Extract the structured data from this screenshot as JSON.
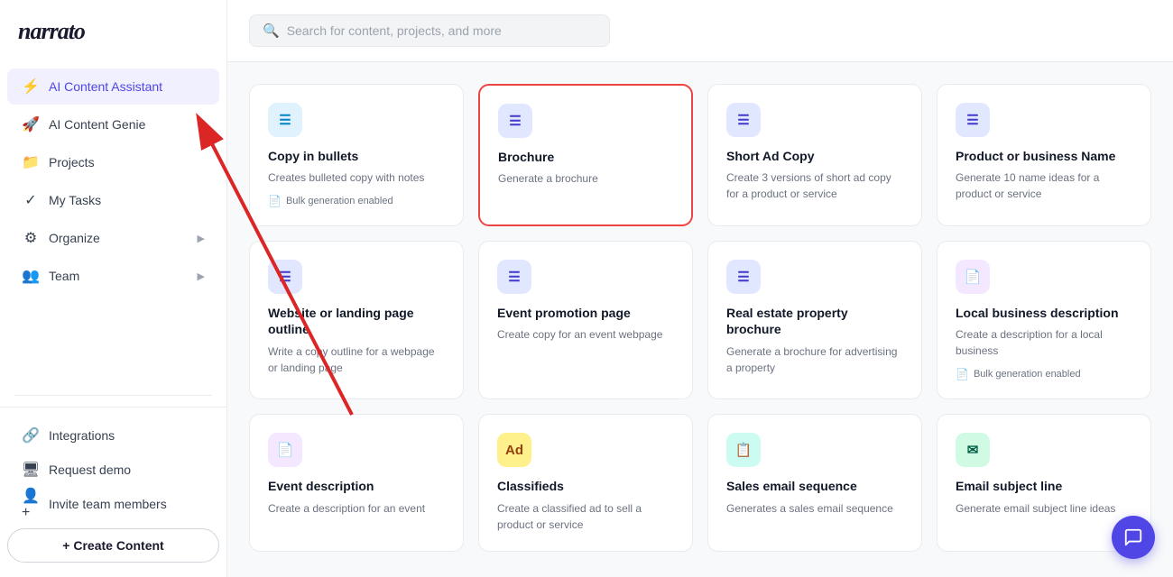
{
  "app": {
    "logo": "narrato"
  },
  "sidebar": {
    "nav_items": [
      {
        "id": "ai-content-assistant",
        "label": "AI Content Assistant",
        "icon": "⚡",
        "active": true,
        "has_chevron": false,
        "icon_color": "#f59e0b"
      },
      {
        "id": "ai-content-genie",
        "label": "AI Content Genie",
        "icon": "🚀",
        "active": false,
        "has_chevron": false,
        "icon_color": "#6366f1"
      },
      {
        "id": "projects",
        "label": "Projects",
        "icon": "📁",
        "active": false,
        "has_chevron": false,
        "icon_color": "#374151"
      },
      {
        "id": "my-tasks",
        "label": "My Tasks",
        "icon": "✓",
        "active": false,
        "has_chevron": false,
        "icon_color": "#374151"
      },
      {
        "id": "organize",
        "label": "Organize",
        "icon": "⚙",
        "active": false,
        "has_chevron": true,
        "icon_color": "#374151"
      },
      {
        "id": "team",
        "label": "Team",
        "icon": "👥",
        "active": false,
        "has_chevron": true,
        "icon_color": "#374151"
      }
    ],
    "bottom_links": [
      {
        "id": "integrations",
        "label": "Integrations",
        "icon": "🔗"
      },
      {
        "id": "request-demo",
        "label": "Request demo",
        "icon": "🖥"
      },
      {
        "id": "invite-team",
        "label": "Invite team members",
        "icon": "👤+"
      }
    ],
    "create_button": "+ Create Content"
  },
  "search": {
    "placeholder": "Search for content, projects, and more"
  },
  "cards": [
    {
      "id": "copy-in-bullets",
      "title": "Copy in bullets",
      "desc": "Creates bulleted copy with notes",
      "badge": "Bulk generation enabled",
      "has_badge": true,
      "icon_bg": "icon-blue",
      "icon": "☰",
      "selected": false
    },
    {
      "id": "brochure",
      "title": "Brochure",
      "desc": "Generate a brochure",
      "badge": "",
      "has_badge": false,
      "icon_bg": "icon-indigo",
      "icon": "☰",
      "selected": true
    },
    {
      "id": "short-ad-copy",
      "title": "Short Ad Copy",
      "desc": "Create 3 versions of short ad copy for a product or service",
      "badge": "",
      "has_badge": false,
      "icon_bg": "icon-indigo",
      "icon": "☰",
      "selected": false
    },
    {
      "id": "product-business-name",
      "title": "Product or business Name",
      "desc": "Generate 10 name ideas for a product or service",
      "badge": "",
      "has_badge": false,
      "icon_bg": "icon-indigo",
      "icon": "☰",
      "selected": false
    },
    {
      "id": "website-landing-page",
      "title": "Website or landing page outline",
      "desc": "Write a copy outline for a webpage or landing page",
      "badge": "",
      "has_badge": false,
      "icon_bg": "icon-indigo",
      "icon": "☰",
      "selected": false
    },
    {
      "id": "event-promotion-page",
      "title": "Event promotion page",
      "desc": "Create copy for an event webpage",
      "badge": "",
      "has_badge": false,
      "icon_bg": "icon-indigo",
      "icon": "☰",
      "selected": false
    },
    {
      "id": "real-estate-brochure",
      "title": "Real estate property brochure",
      "desc": "Generate a brochure for advertising a property",
      "badge": "",
      "has_badge": false,
      "icon_bg": "icon-indigo",
      "icon": "☰",
      "selected": false
    },
    {
      "id": "local-business-description",
      "title": "Local business description",
      "desc": "Create a description for a local business",
      "badge": "Bulk generation enabled",
      "has_badge": true,
      "icon_bg": "icon-purple",
      "icon": "📄",
      "selected": false
    },
    {
      "id": "event-description",
      "title": "Event description",
      "desc": "Create a description for an event",
      "badge": "",
      "has_badge": false,
      "icon_bg": "icon-purple",
      "icon": "📄",
      "selected": false
    },
    {
      "id": "classifieds",
      "title": "Classifieds",
      "desc": "Create a classified ad to sell a product or service",
      "badge": "",
      "has_badge": false,
      "icon_bg": "icon-yellow",
      "icon": "Ad",
      "selected": false
    },
    {
      "id": "sales-email-sequence",
      "title": "Sales email sequence",
      "desc": "Generates a sales email sequence",
      "badge": "",
      "has_badge": false,
      "icon_bg": "icon-teal",
      "icon": "📋",
      "selected": false
    },
    {
      "id": "email-subject-line",
      "title": "Email subject line",
      "desc": "Generate email subject line ideas",
      "badge": "",
      "has_badge": false,
      "icon_bg": "icon-green",
      "icon": "✉",
      "selected": false
    }
  ]
}
